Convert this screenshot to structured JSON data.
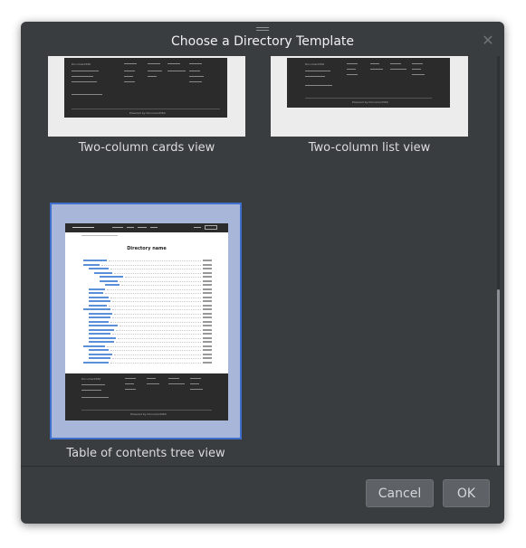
{
  "dialog": {
    "title": "Choose a Directory Template",
    "close_label": "✕"
  },
  "templates": [
    {
      "caption": "Two-column cards view",
      "selected": false
    },
    {
      "caption": "Two-column list view",
      "selected": false
    },
    {
      "caption": "Table of contents tree view",
      "selected": true
    }
  ],
  "preview": {
    "page_title": "Directory name",
    "footer_brand": "Document360",
    "powered_by": "Powered by Document360"
  },
  "footer": {
    "cancel_label": "Cancel",
    "ok_label": "OK"
  },
  "colors": {
    "dialog_bg": "#3a3d40",
    "selection_border": "#3f6fcc",
    "selection_fill": "#a8b6da",
    "button_bg": "#5e6266"
  }
}
